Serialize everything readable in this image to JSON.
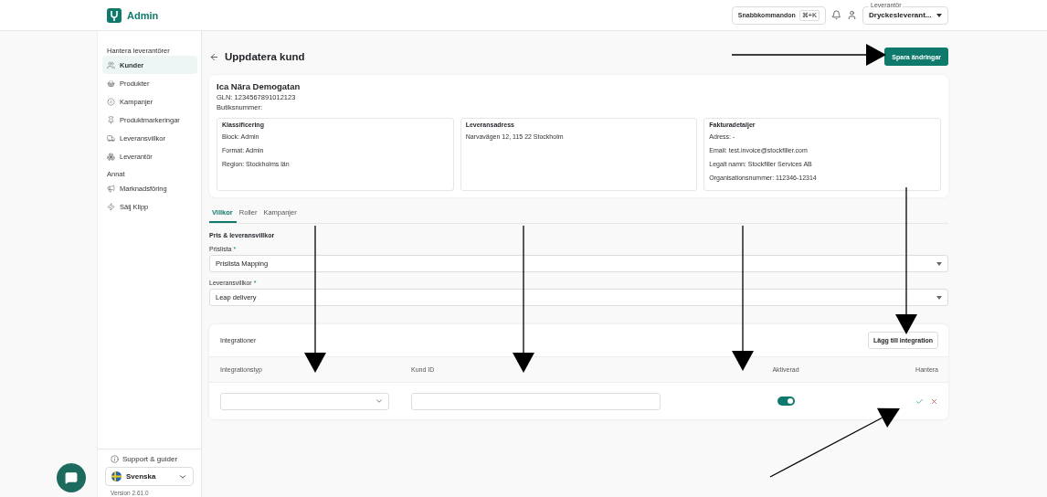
{
  "header": {
    "logo_text": "Admin",
    "command_button": {
      "label": "Snabbkommandon",
      "shortcut": "⌘+K"
    },
    "supplier_select": {
      "label": "Leverantör",
      "value": "Dryckesleverant..."
    }
  },
  "sidebar": {
    "sections": [
      {
        "title": "Hantera leverantörer",
        "items": [
          {
            "label": "Kunder",
            "selected": true
          },
          {
            "label": "Produkter",
            "selected": false
          },
          {
            "label": "Kampanjer",
            "selected": false
          },
          {
            "label": "Produktmarkeringar",
            "selected": false
          },
          {
            "label": "Leveransvillkor",
            "selected": false
          },
          {
            "label": "Leverantör",
            "selected": false
          }
        ]
      },
      {
        "title": "Annat",
        "items": [
          {
            "label": "Marknadsföring",
            "selected": false
          },
          {
            "label": "Sälj Klipp",
            "selected": false
          }
        ]
      }
    ],
    "support_link": "Support & guider",
    "language": "Svenska",
    "version": "Version 2.61.0"
  },
  "page": {
    "title": "Uppdatera kund",
    "save_button": "Spara ändringar"
  },
  "customer": {
    "name": "Ica Nära Demogatan",
    "gln": "GLN: 1234567891012123",
    "store_number": "Butiksnummer:",
    "panels": [
      {
        "title": "Klassificering",
        "lines": [
          "Block: Admin",
          "Format: Admin",
          "Region: Stockholms län"
        ]
      },
      {
        "title": "Leveransadress",
        "lines": [
          "Narvavägen 12, 115 22 Stockholm"
        ]
      },
      {
        "title": "Fakturadetaljer",
        "lines": [
          "Adress: -",
          "Email: test.invoice@stockfiller.com",
          "Legalt namn: Stockfiller Services AB",
          "Organisationsnummer: 112346-12314"
        ]
      }
    ]
  },
  "tabs": [
    {
      "label": "Villkor",
      "selected": true
    },
    {
      "label": "Roller",
      "selected": false
    },
    {
      "label": "Kampanjer",
      "selected": false
    }
  ],
  "terms": {
    "heading": "Pris & leveransvillkor",
    "fields": [
      {
        "label": "Prislista",
        "required_mark": "*",
        "value": "Prislista Mapping"
      },
      {
        "label": "Leveransvillkor",
        "required_mark": "*",
        "value": "Leap delivery"
      }
    ]
  },
  "integrations": {
    "title": "Integrationer",
    "add_button": "Lägg till integration",
    "columns": [
      "Integrationstyp",
      "Kund ID",
      "Aktiverad",
      "Hantera"
    ],
    "rows": [
      {
        "activated": true
      }
    ]
  }
}
